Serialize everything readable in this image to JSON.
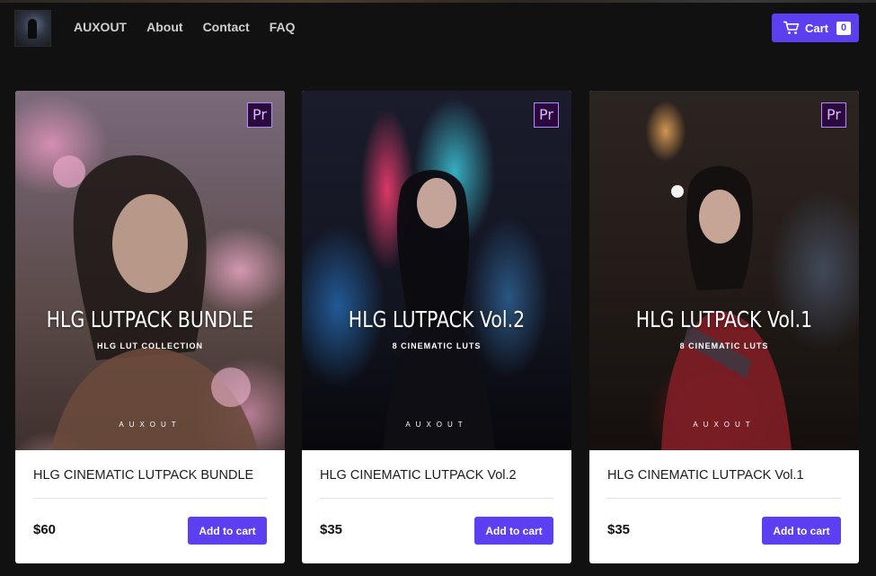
{
  "header": {
    "nav": [
      "AUXOUT",
      "About",
      "Contact",
      "FAQ"
    ],
    "cart_label": "Cart",
    "cart_count": "0"
  },
  "products": [
    {
      "cover_title": "HLG LUTPACK BUNDLE",
      "cover_subtitle": "HLG LUT COLLECTION",
      "cover_brand": "AUXOUT",
      "badge": "Pr",
      "title": "HLG CINEMATIC LUTPACK BUNDLE",
      "price": "$60",
      "button": "Add to cart"
    },
    {
      "cover_title": "HLG LUTPACK Vol.2",
      "cover_subtitle": "8 CINEMATIC LUTS",
      "cover_brand": "AUXOUT",
      "badge": "Pr",
      "title": "HLG CINEMATIC LUTPACK Vol.2",
      "price": "$35",
      "button": "Add to cart"
    },
    {
      "cover_title": "HLG LUTPACK Vol.1",
      "cover_subtitle": "8 CINEMATIC LUTS",
      "cover_brand": "AUXOUT",
      "badge": "Pr",
      "title": "HLG CINEMATIC LUTPACK Vol.1",
      "price": "$35",
      "button": "Add to cart"
    }
  ],
  "colors": {
    "background": "#121111",
    "accent": "#5b3ff0",
    "card": "#ffffff"
  }
}
